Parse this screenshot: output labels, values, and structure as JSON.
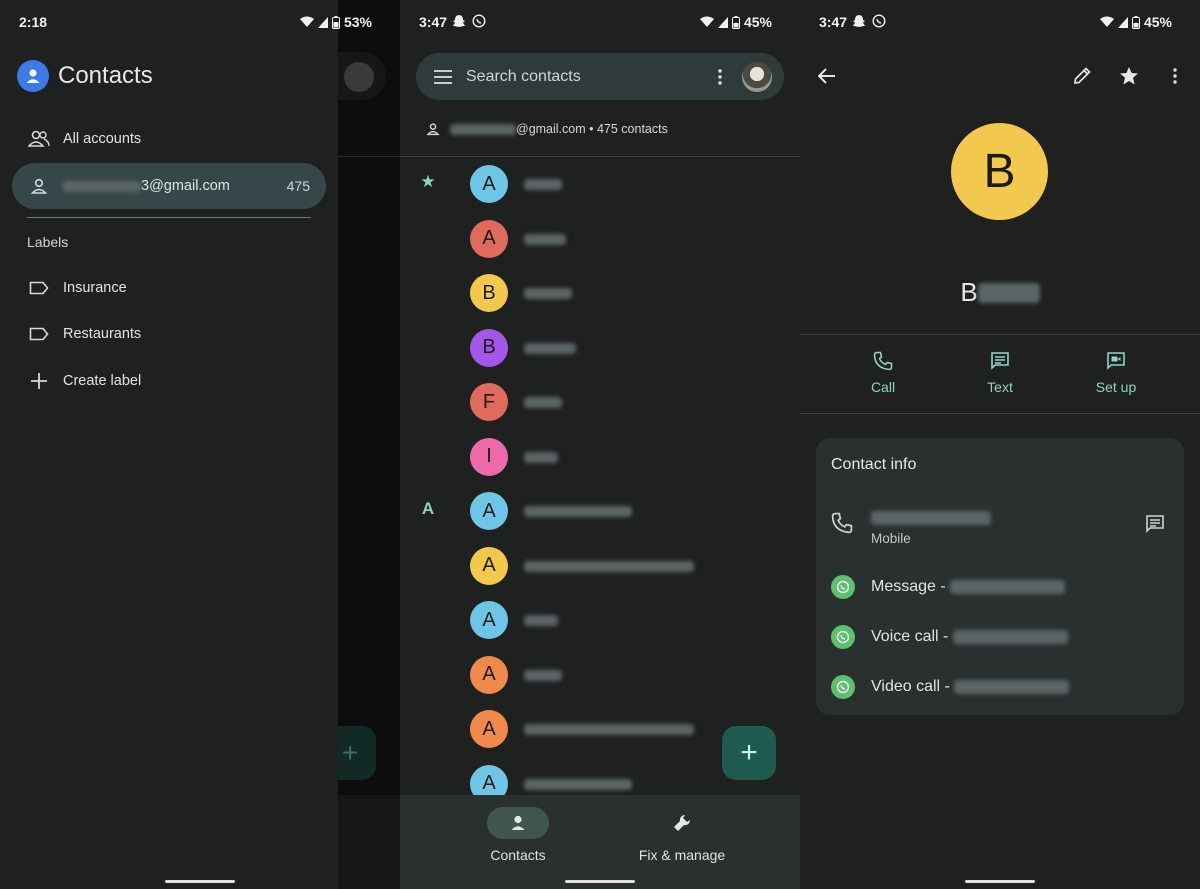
{
  "panel1": {
    "status": {
      "time": "2:18",
      "battery": "53%"
    },
    "drawer": {
      "title": "Contacts",
      "all_accounts": "All accounts",
      "account_email": "3@gmail.com",
      "account_count": "475",
      "labels_heading": "Labels",
      "labels": [
        "Insurance",
        "Restaurants"
      ],
      "create_label": "Create label"
    }
  },
  "panel2": {
    "status": {
      "time": "3:47",
      "battery": "45%"
    },
    "search": {
      "placeholder": "Search contacts"
    },
    "account_summary": "@gmail.com • 475 contacts",
    "section_starred": "★",
    "section_a": "A",
    "contacts": [
      {
        "initial": "A",
        "color": "#6ec6e6"
      },
      {
        "initial": "A",
        "color": "#e06b5d"
      },
      {
        "initial": "B",
        "color": "#f2c94c"
      },
      {
        "initial": "B",
        "color": "#a357e8"
      },
      {
        "initial": "F",
        "color": "#e06b5d"
      },
      {
        "initial": "I",
        "color": "#ef6aa8"
      },
      {
        "initial": "A",
        "color": "#6ec6e6"
      },
      {
        "initial": "A",
        "color": "#f2c94c"
      },
      {
        "initial": "A",
        "color": "#6ec6e6"
      },
      {
        "initial": "A",
        "color": "#f08a4b"
      },
      {
        "initial": "A",
        "color": "#f08a4b"
      },
      {
        "initial": "A",
        "color": "#6ec6e6"
      }
    ],
    "fab": "+",
    "nav": {
      "contacts": "Contacts",
      "fix_manage": "Fix & manage"
    }
  },
  "panel3": {
    "status": {
      "time": "3:47",
      "battery": "45%"
    },
    "avatar_initial": "B",
    "name_initial": "B",
    "actions": {
      "call": "Call",
      "text": "Text",
      "setup": "Set up"
    },
    "contact_info": {
      "title": "Contact info",
      "phone_type": "Mobile",
      "message": "Message -",
      "voice_call": "Voice call -",
      "video_call": "Video call -"
    }
  },
  "colors": {
    "accent": "#8fd5c7",
    "whatsapp": "#5ac26a",
    "avatar_b": "#f2c94c"
  }
}
